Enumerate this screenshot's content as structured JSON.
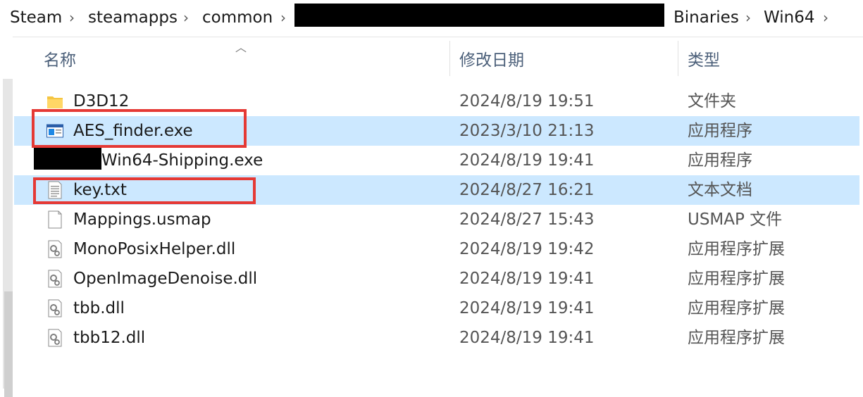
{
  "breadcrumb": {
    "items": [
      "Steam",
      "steamapps",
      "common",
      "Binaries",
      "Win64"
    ]
  },
  "columns": {
    "name": "名称",
    "modified": "修改日期",
    "type": "类型"
  },
  "files": [
    {
      "name": "D3D12",
      "modified": "2024/8/19 19:51",
      "type": "文件夹",
      "icon": "folder-icon",
      "selected": false
    },
    {
      "name": "AES_finder.exe",
      "modified": "2023/3/10 21:13",
      "type": "应用程序",
      "icon": "application-icon",
      "selected": true
    },
    {
      "name": "Win64-Shipping.exe",
      "modified": "2024/8/19 19:41",
      "type": "应用程序",
      "icon": "application-icon",
      "selected": false
    },
    {
      "name": "key.txt",
      "modified": "2024/8/27 16:21",
      "type": "文本文档",
      "icon": "text-file-icon",
      "selected": true
    },
    {
      "name": "Mappings.usmap",
      "modified": "2024/8/27 15:43",
      "type": "USMAP 文件",
      "icon": "blank-file-icon",
      "selected": false
    },
    {
      "name": "MonoPosixHelper.dll",
      "modified": "2024/8/19 19:42",
      "type": "应用程序扩展",
      "icon": "dll-file-icon",
      "selected": false
    },
    {
      "name": "OpenImageDenoise.dll",
      "modified": "2024/8/19 19:41",
      "type": "应用程序扩展",
      "icon": "dll-file-icon",
      "selected": false
    },
    {
      "name": "tbb.dll",
      "modified": "2024/8/19 19:41",
      "type": "应用程序扩展",
      "icon": "dll-file-icon",
      "selected": false
    },
    {
      "name": "tbb12.dll",
      "modified": "2024/8/19 19:41",
      "type": "应用程序扩展",
      "icon": "dll-file-icon",
      "selected": false
    }
  ],
  "colors": {
    "selection": "#cce8ff",
    "highlight_box": "#e53935",
    "header_text": "#4c607a"
  }
}
